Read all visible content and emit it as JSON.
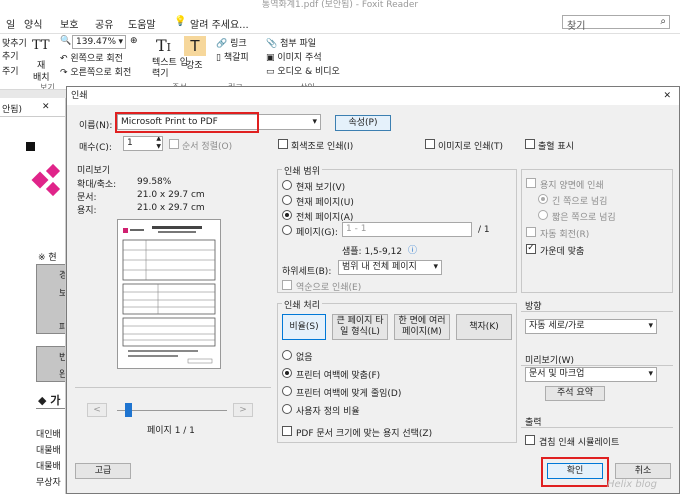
{
  "window": {
    "title": "통역화계1.pdf (보안됨) - Foxit Reader"
  },
  "menu": [
    "일",
    "양식",
    "보호",
    "공유",
    "도움말",
    "알려 주세요..."
  ],
  "search_placeholder": "찾기",
  "ribbon": {
    "left_tools": [
      "맞추기",
      "추기",
      "주기"
    ],
    "tt_label": "TT",
    "reflow": [
      "재",
      "배치"
    ],
    "view_group": "보기",
    "zoom_value": "139.47%",
    "rotate_left": "왼쪽으로 회전",
    "rotate_right": "오른쪽으로 회전",
    "text_tool": "텍스트 입력기",
    "highlight": "강조",
    "comment_group": "주석",
    "link": "링크",
    "bookmark": "책갈피",
    "link_group": "링크",
    "attach": "첨부 파일",
    "image_comment": "이미지 주석",
    "audio_video": "오디오 & 비디오",
    "insert_group": "삽입"
  },
  "leftpanel": {
    "tab": "안됨)",
    "table_heading": "※ 현",
    "bullet": "◆ 가",
    "cells": [
      "경",
      "보",
      "피",
      "번",
      "완"
    ],
    "rows": [
      "대인배",
      "대물배",
      "대물배",
      "무상자"
    ]
  },
  "dialog": {
    "title": "인쇄",
    "name_label": "이름(N):",
    "printer": "Microsoft Print to PDF",
    "properties": "속성(P)",
    "copies_label": "매수(C):",
    "copies": "1",
    "collate": "순서 정렬(O)",
    "grayscale": "회색조로 인쇄(I)",
    "print_as_image": "이미지로 인쇄(T)",
    "output_display": "출혈 표시",
    "preview": {
      "title": "미리보기",
      "zoom_label": "확대/축소:",
      "zoom": "99.58%",
      "doc_label": "문서:",
      "doc_size": "21.0 x 29.7 cm",
      "paper_label": "용지:",
      "paper_size": "21.0 x 29.7 cm",
      "page_text": "페이지 1 / 1",
      "prev": "<",
      "next": ">",
      "thumb_heading": "eYou다이렉트_계약후 자동차 해지신청서"
    },
    "range": {
      "title": "인쇄 범위",
      "current_view": "현재 보기(V)",
      "current_page": "현재 페이지(U)",
      "all_pages": "전체 페이지(A)",
      "pages": "페이지(G):",
      "pages_value": "1 - 1",
      "pages_total": "/ 1",
      "sample": "샘플: 1,5-9,12",
      "subset_label": "하위세트(B):",
      "subset": "범위 내 전체 페이지",
      "reverse": "역순으로 인쇄(E)"
    },
    "handling": {
      "title": "인쇄 처리",
      "scale": "비율(S)",
      "tile": "큰 페이지 타일 형식(L)",
      "multiple": "한 면에 여러 페이지(M)",
      "booklet": "책자(K)",
      "none": "없음",
      "fit_margins": "프린터 여백에 맞춤(F)",
      "shrink": "프린터 여백에 맞게 줄임(D)",
      "custom": "사용자 정의 비율",
      "pdf_paper": "PDF 문서 크기에 맞는 용지 선택(Z)"
    },
    "duplex": {
      "both_sides": "용지 양면에 인쇄",
      "long_edge": "긴 쪽으로 넘김",
      "short_edge": "짧은 쪽으로 넘김",
      "auto_rotate": "자동 회전(R)",
      "auto_center": "가운데 맞춤"
    },
    "orientation": {
      "title": "방향",
      "value": "자동 세로/가로"
    },
    "preview_sel": {
      "title": "미리보기(W)",
      "value": "문서 및 마크업",
      "summary": "주석 요약"
    },
    "output": {
      "title": "출력",
      "simulate": "겹침 인쇄 시뮬레이트"
    },
    "advanced": "고급",
    "ok": "확인",
    "cancel": "취소",
    "watermark": "Helix blog"
  },
  "colors": {
    "accent": "#e02020",
    "blue_btn": "#e5f1fb"
  }
}
